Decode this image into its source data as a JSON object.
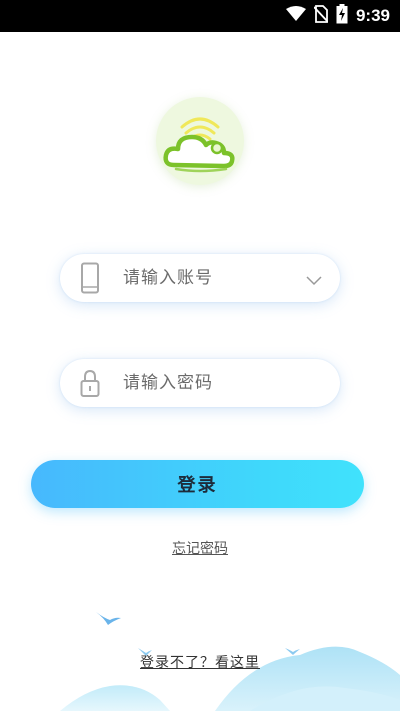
{
  "status_bar": {
    "time": "9:39",
    "icons": [
      "wifi-icon",
      "no-sim-icon",
      "battery-charging-icon"
    ]
  },
  "app": {
    "logo": "cloud-wifi-logo"
  },
  "login_form": {
    "account_placeholder": "请输入账号",
    "password_placeholder": "请输入密码",
    "account_icon": "phone-icon",
    "password_icon": "lock-icon",
    "dropdown_icon": "chevron-down-icon",
    "submit_label": "登录",
    "forgot_label": "忘记密码",
    "help_label": "登录不了？看这里"
  },
  "colors": {
    "button_gradient_start": "#47b8fd",
    "button_gradient_end": "#40e2fc",
    "logo_green": "#7cc22a",
    "logo_yellow": "#f3e85a",
    "mountain_blue": "#b9e6f7"
  }
}
